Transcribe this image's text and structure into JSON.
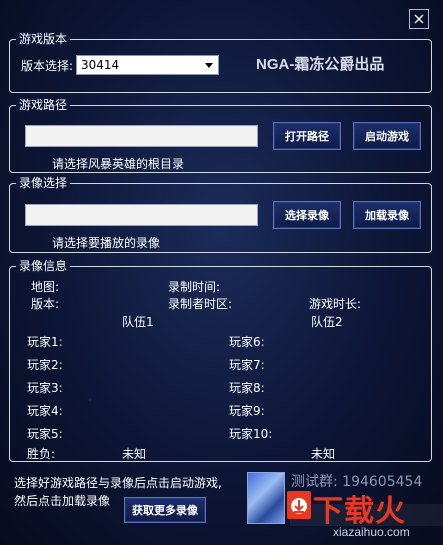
{
  "window": {
    "close_icon": "close-icon"
  },
  "version_group": {
    "title": "游戏版本",
    "label": "版本选择:",
    "selected": "30414",
    "brand": "NGA-霜冻公爵出品"
  },
  "path_group": {
    "title": "游戏路径",
    "input_value": "",
    "open_path_button": "打开路径",
    "launch_button": "启动游戏",
    "hint": "请选择风暴英雄的根目录"
  },
  "replay_group": {
    "title": "录像选择",
    "input_value": "",
    "select_button": "选择录像",
    "load_button": "加载录像",
    "hint": "请选择要播放的录像"
  },
  "info_group": {
    "title": "录像信息",
    "map_label": "地图:",
    "record_time_label": "录制时间:",
    "version_label": "版本:",
    "timezone_label": "录制者时区:",
    "duration_label": "游戏时长:",
    "team1": {
      "title": "队伍1",
      "players": [
        "玩家1:",
        "玩家2:",
        "玩家3:",
        "玩家4:",
        "玩家5:"
      ],
      "result_label": "胜负:",
      "result_value": "未知"
    },
    "team2": {
      "title": "队伍2",
      "players": [
        "玩家6:",
        "玩家7:",
        "玩家8:",
        "玩家9:",
        "玩家10:"
      ],
      "result_value": "未知"
    }
  },
  "footer": {
    "instruction_line1": "选择好游戏路径与录像后点击启动游戏,",
    "instruction_line2": "然后点击加载录像",
    "more_replays_button": "获取更多录像",
    "qq_group": "测试群: 194605454"
  },
  "watermark": {
    "logo_text": "下载火",
    "site": "xiazaihuo.com",
    "accent": "#e8381f"
  }
}
